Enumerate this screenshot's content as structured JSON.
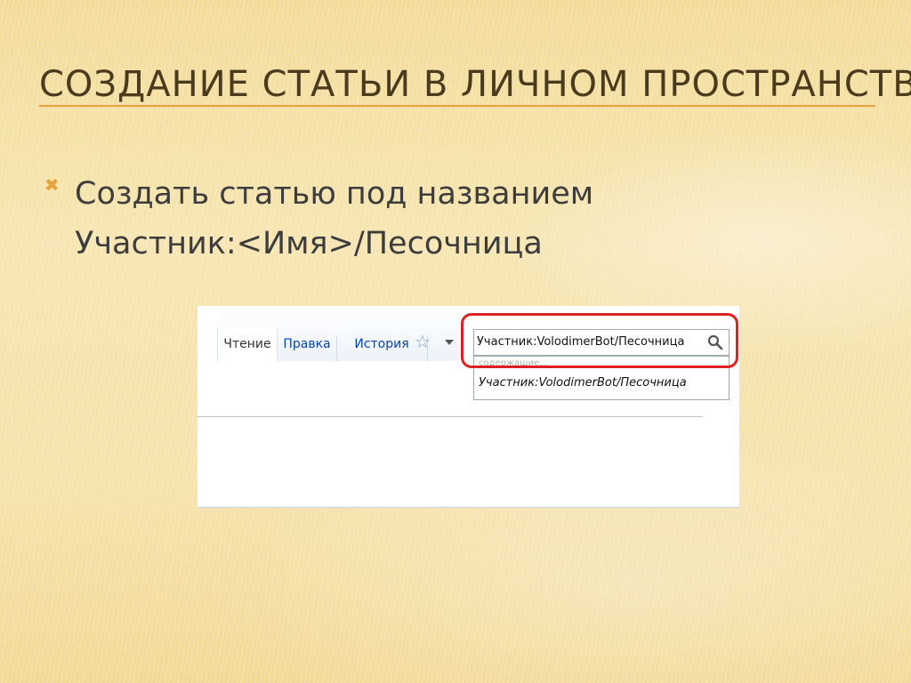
{
  "slide": {
    "title": "Создание статьи в личном пространстве",
    "bullet_lines": [
      "Создать статью под названием",
      "Участник:<Имя>/Песочница"
    ]
  },
  "screenshot": {
    "tabs": [
      {
        "label": "Чтение"
      },
      {
        "label": "Правка"
      },
      {
        "label": "История"
      }
    ],
    "search": {
      "value": "Участник:VolodimerBot/Песочница"
    },
    "suggestions": {
      "header": "содержащие...",
      "items": [
        "Участник:VolodimerBot/Песочница"
      ]
    },
    "icons": {
      "star": "star-icon",
      "dropdown": "chevron-down-icon",
      "search": "search-icon",
      "bullet": "cross-bullet-icon"
    },
    "colors": {
      "link": "#0645ad",
      "highlight": "#e02020",
      "accent": "#e6a23c"
    }
  }
}
